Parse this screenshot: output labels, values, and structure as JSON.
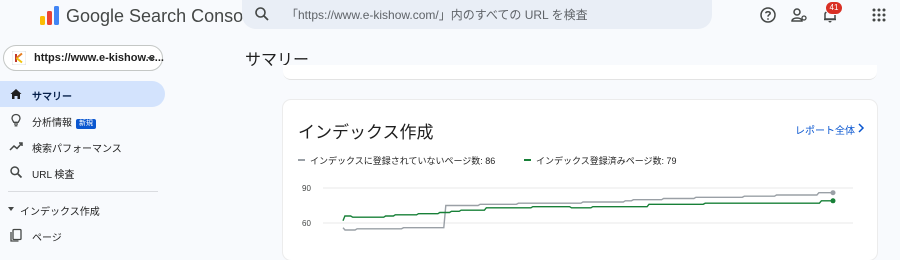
{
  "app": {
    "brand": "Google Search Console",
    "search_placeholder": "「https://www.e-kishow.com/」内のすべての URL を検査",
    "notification_count": "41"
  },
  "sidebar": {
    "property": "https://www.e-kishow.c...",
    "items": [
      {
        "label": "サマリー",
        "icon": "home-icon",
        "active": true
      },
      {
        "label": "分析情報",
        "icon": "lightbulb-icon",
        "badge": "新規"
      },
      {
        "label": "検索パフォーマンス",
        "icon": "trending-icon"
      },
      {
        "label": "URL 検査",
        "icon": "search-icon"
      }
    ],
    "section": {
      "label": "インデックス作成",
      "items": [
        {
          "label": "ページ",
          "icon": "pages-icon"
        }
      ]
    }
  },
  "main": {
    "page_title": "サマリー",
    "card": {
      "title": "インデックス作成",
      "link_label": "レポート全体",
      "legend": [
        {
          "label": "インデックスに登録されていないページ数: 86",
          "color": "#9aa0a6"
        },
        {
          "label": "インデックス登録済みページ数: 79",
          "color": "#188038"
        }
      ]
    }
  },
  "chart_data": {
    "type": "line",
    "y_ticks": [
      "90",
      "60"
    ],
    "ylim": [
      50,
      95
    ],
    "series": [
      {
        "name": "インデックスに登録されていないページ数: 86",
        "color": "#9aa0a6",
        "values": [
          56,
          54,
          54,
          54,
          54,
          54,
          54,
          55,
          55,
          55,
          55,
          55,
          55,
          55,
          55,
          55,
          55,
          55,
          55,
          55,
          55,
          55,
          55,
          55,
          55,
          55,
          55,
          55,
          55,
          55,
          56,
          56,
          56,
          56,
          56,
          56,
          56,
          56,
          56,
          56,
          56,
          56,
          56,
          56,
          56,
          56,
          56,
          56,
          56,
          56,
          56,
          75,
          75,
          75,
          75,
          75,
          75,
          75,
          75,
          75,
          75,
          75,
          75,
          75,
          75,
          75,
          75,
          75,
          76,
          76,
          76,
          76,
          76,
          76,
          76,
          76,
          76,
          76,
          76,
          76,
          76,
          76,
          76,
          76,
          76,
          76,
          76,
          77,
          77,
          77,
          77,
          77,
          77,
          77,
          77,
          77,
          77,
          77,
          77,
          77,
          77,
          77,
          77,
          77,
          77,
          77,
          77,
          77,
          77,
          77,
          77,
          77,
          77,
          77,
          77,
          77,
          77,
          77,
          77,
          78,
          78,
          78,
          78,
          78,
          78,
          78,
          78,
          78,
          78,
          78,
          78,
          78,
          78,
          78,
          78,
          78,
          78,
          78,
          78,
          78,
          79,
          79,
          79,
          79,
          80,
          80,
          80,
          80,
          80,
          80,
          80,
          80,
          80,
          80,
          80,
          80,
          80,
          80,
          80,
          81,
          81,
          81,
          81,
          81,
          81,
          81,
          81,
          81,
          81,
          81,
          81,
          81,
          81,
          81,
          81,
          82,
          82,
          82,
          82,
          82,
          82,
          82,
          82,
          82,
          82,
          82,
          82,
          82,
          82,
          82,
          82,
          82,
          82,
          82,
          82,
          82,
          82,
          82,
          82,
          83,
          83,
          83,
          83,
          83,
          83,
          83,
          83,
          83,
          83,
          83,
          83,
          83,
          83,
          83,
          83,
          84,
          84,
          84,
          84,
          84,
          84,
          84,
          84,
          84,
          84,
          84,
          84,
          84,
          84,
          84,
          84,
          84,
          84,
          84,
          84,
          84,
          86,
          86,
          86,
          86,
          86,
          86,
          86,
          86
        ]
      },
      {
        "name": "インデックス登録済みページ数: 79",
        "color": "#188038",
        "values": [
          62,
          66,
          66,
          66,
          66,
          65,
          65,
          65,
          65,
          65,
          65,
          65,
          65,
          65,
          65,
          65,
          65,
          65,
          65,
          65,
          65,
          65,
          66,
          66,
          66,
          66,
          66,
          67,
          67,
          67,
          67,
          67,
          67,
          67,
          67,
          67,
          67,
          67,
          67,
          68,
          68,
          68,
          68,
          68,
          68,
          68,
          68,
          68,
          68,
          68,
          69,
          69,
          69,
          69,
          69,
          69,
          70,
          70,
          70,
          70,
          70,
          71,
          71,
          71,
          71,
          71,
          71,
          71,
          71,
          71,
          71,
          71,
          71,
          71,
          73,
          73,
          73,
          73,
          73,
          73,
          73,
          73,
          73,
          73,
          73,
          73,
          73,
          73,
          73,
          73,
          73,
          73,
          73,
          73,
          73,
          73,
          73,
          73,
          74,
          74,
          74,
          74,
          74,
          74,
          74,
          74,
          74,
          74,
          74,
          74,
          74,
          74,
          74,
          74,
          74,
          74,
          74,
          74,
          73,
          73,
          73,
          73,
          73,
          73,
          73,
          73,
          73,
          73,
          73,
          74,
          74,
          74,
          74,
          74,
          74,
          74,
          74,
          74,
          74,
          74,
          74,
          74,
          74,
          74,
          74,
          74,
          74,
          74,
          74,
          74,
          74,
          74,
          74,
          74,
          74,
          74,
          74,
          74,
          76,
          76,
          76,
          76,
          76,
          76,
          76,
          76,
          76,
          76,
          76,
          76,
          76,
          76,
          76,
          76,
          76,
          76,
          76,
          76,
          76,
          76,
          76,
          76,
          76,
          76,
          76,
          76,
          76,
          77,
          77,
          77,
          77,
          77,
          77,
          77,
          77,
          77,
          77,
          77,
          77,
          77,
          77,
          77,
          77,
          77,
          77,
          77,
          77,
          77,
          77,
          77,
          77,
          77,
          77,
          77,
          77,
          77,
          77,
          77,
          77,
          77,
          77,
          77,
          77,
          77,
          77,
          77,
          77,
          77,
          77,
          77,
          77,
          77,
          77,
          77,
          77,
          77,
          77,
          77,
          77,
          77,
          77,
          77,
          77,
          77,
          77,
          77,
          77,
          79,
          79,
          79,
          79,
          79,
          79,
          79
        ]
      }
    ]
  }
}
